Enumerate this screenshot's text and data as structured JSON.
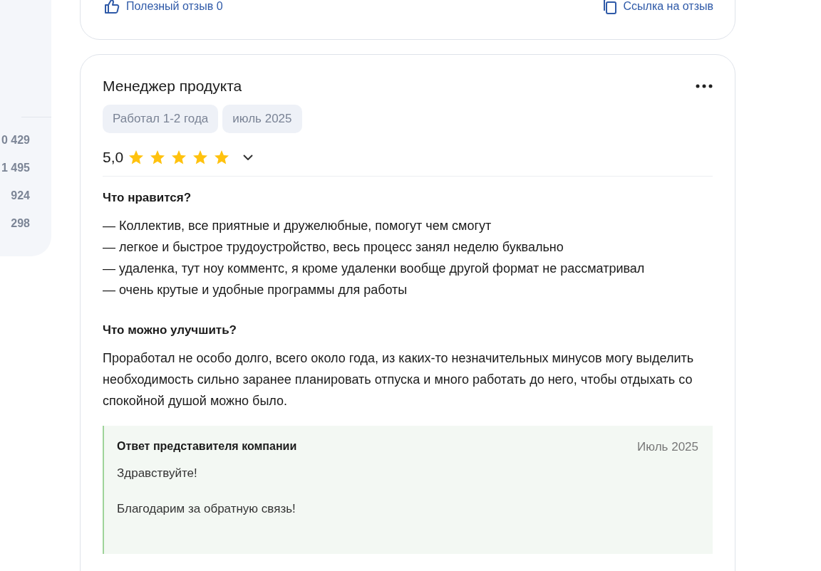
{
  "sidebar": {
    "counts": [
      "0 429",
      "1 495",
      "924",
      "298"
    ]
  },
  "previous_review": {
    "actions": [
      {
        "kind": "like",
        "label": "Полезный отзыв 0"
      },
      {
        "kind": "link",
        "label": "Ссылка на отзыв"
      }
    ]
  },
  "review": {
    "title": "Менеджер продукта",
    "tags": [
      "Работал 1-2 года",
      "июль 2025"
    ],
    "rating": "5,0",
    "stars": 5,
    "sections": [
      {
        "heading": "Что нравится?",
        "paragraphs": [
          "— Коллектив, все приятные и дружелюбные, помогут чем смогут",
          "— легкое и быстрое трудоустройство, весь процесс занял неделю буквально",
          "— удаленка, тут ноу комментс, я кроме удаленки вообще другой формат не рассматривал",
          "— очень крутые и удобные программы для работы"
        ]
      },
      {
        "heading": "Что можно улучшить?",
        "paragraphs": [
          "Проработал не особо долго, всего около года, из каких-то незначительных минусов могу выделить необходимость сильно заранее планировать отпуска и много работать до него, чтобы отдыхать со спокойной душой можно было."
        ]
      }
    ],
    "reply": {
      "title": "Ответ представителя компании",
      "date": "Июль 2025",
      "paragraphs": [
        "Здравствуйте!",
        "Благодарим за обратную связь!"
      ]
    }
  }
}
